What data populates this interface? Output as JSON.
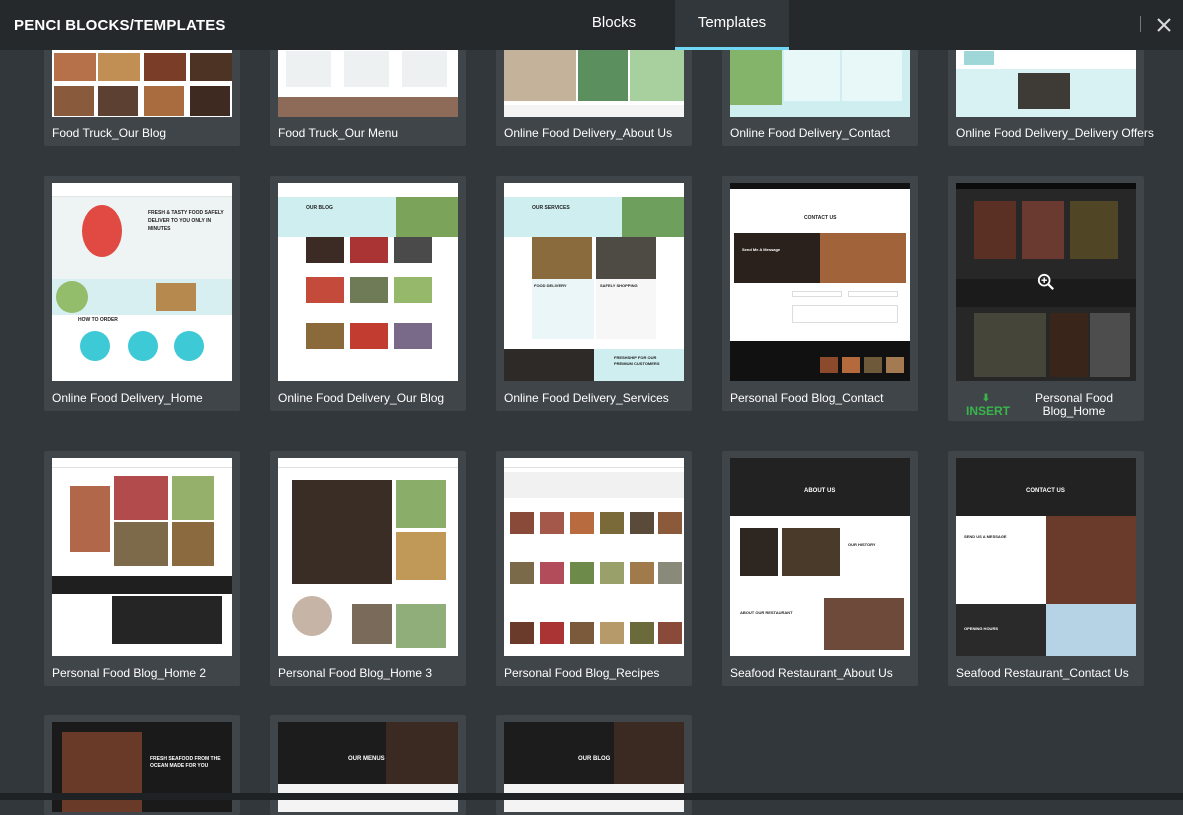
{
  "app": {
    "title": "PENCI BLOCKS/TEMPLATES"
  },
  "tabs": [
    {
      "label": "Blocks",
      "active": false
    },
    {
      "label": "Templates",
      "active": true
    }
  ],
  "colors": {
    "accent": "#71d7f7",
    "insert": "#39b54a",
    "background": "#32373c",
    "header": "#26292c",
    "card": "#40454a"
  },
  "icons": {
    "close": "close-icon",
    "insert": "download-icon",
    "zoom": "zoom-in-icon"
  },
  "templates": [
    {
      "name": "Food Truck_Our Blog",
      "theme": "light"
    },
    {
      "name": "Food Truck_Our Menu",
      "theme": "light"
    },
    {
      "name": "Online Food Delivery_About Us",
      "theme": "light"
    },
    {
      "name": "Online Food Delivery_Contact",
      "theme": "light"
    },
    {
      "name": "Online Food Delivery_Delivery Offers",
      "theme": "light"
    },
    {
      "name": "Online Food Delivery_Home",
      "theme": "light"
    },
    {
      "name": "Online Food Delivery_Our Blog",
      "theme": "light"
    },
    {
      "name": "Online Food Delivery_Services",
      "theme": "light"
    },
    {
      "name": "Personal Food Blog_Contact",
      "theme": "light"
    },
    {
      "name": "Personal Food Blog_Home",
      "theme": "light",
      "hovered": true,
      "insert_label": "INSERT"
    },
    {
      "name": "Personal Food Blog_Home 2",
      "theme": "light"
    },
    {
      "name": "Personal Food Blog_Home 3",
      "theme": "light"
    },
    {
      "name": "Personal Food Blog_Recipes",
      "theme": "light"
    },
    {
      "name": "Seafood Restaurant_About Us",
      "theme": "dark"
    },
    {
      "name": "Seafood Restaurant_Contact Us",
      "theme": "dark"
    },
    {
      "name": "",
      "theme": "dark"
    },
    {
      "name": "",
      "theme": "dark"
    },
    {
      "name": "",
      "theme": "dark"
    }
  ],
  "thumb_text": {
    "t5_headline": "FRESH & TASTY FOOD SAFELY DELIVER TO YOU ONLY IN MINUTES",
    "t5_how": "HOW TO ORDER",
    "t6_title": "OUR BLOG",
    "t7_title": "OUR SERVICES",
    "t7_food": "FOOD DELIVERY",
    "t7_ship": "SAFELY SHOPPING",
    "t7_fresh": "FRESHSHIP FOR OUR PREMIUM CUSTOMERS",
    "t8_contact": "CONTACT US",
    "t8_send": "Send Me A Message",
    "t13_about": "ABOUT US",
    "t13_history": "OUR HISTORY",
    "t13_rest": "ABOUT OUR RESTAURANT",
    "t14_contact": "CONTACT US",
    "t14_send": "SEND US A MESSAGE",
    "t14_hours": "OPENING HOURS",
    "t15_fresh": "FRESH SEAFOOD FROM THE OCEAN MADE FOR YOU",
    "t16_menus": "OUR MENUS",
    "t17_blog": "OUR BLOG"
  }
}
